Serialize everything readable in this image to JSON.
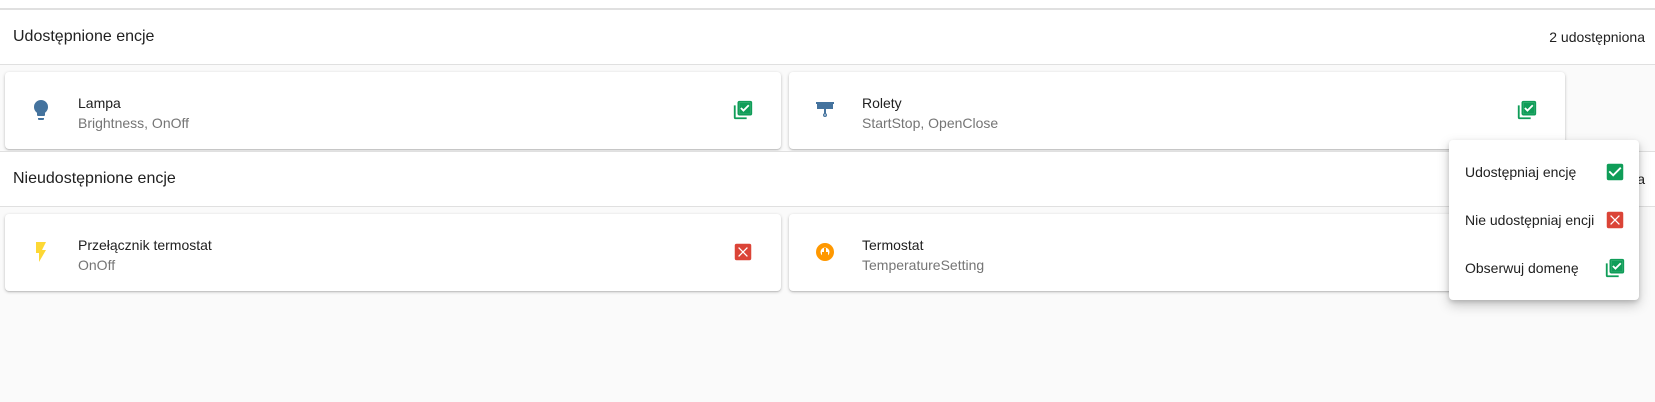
{
  "shared": {
    "title": "Udostępnione encje",
    "count": "2 udostępniona",
    "entities": [
      {
        "name": "Lampa",
        "traits": "Brightness, OnOff",
        "icon": "lightbulb-icon",
        "status_icon": "multi-check-icon"
      },
      {
        "name": "Rolety",
        "traits": "StartStop, OpenClose",
        "icon": "blinds-icon",
        "status_icon": "multi-check-icon"
      }
    ]
  },
  "unshared": {
    "title": "Nieudostępnione encje",
    "count_visible_fragment": "a",
    "entities": [
      {
        "name": "Przełącznik termostat",
        "traits": "OnOff",
        "icon": "flash-icon",
        "status_icon": "close-box-icon"
      },
      {
        "name": "Termostat",
        "traits": "TemperatureSetting",
        "icon": "thermostat-icon",
        "status_icon": ""
      }
    ]
  },
  "menu": {
    "items": [
      {
        "label": "Udostępniaj encję",
        "icon": "check-box-icon"
      },
      {
        "label": "Nie udostępniaj encji",
        "icon": "close-box-icon"
      },
      {
        "label": "Obserwuj domenę",
        "icon": "multi-check-icon"
      }
    ]
  },
  "colors": {
    "green": "#0f9d58",
    "red": "#db4437",
    "blue_icon": "#44739e",
    "yellow_icon": "#fdd835",
    "orange_icon": "#ff9800"
  }
}
